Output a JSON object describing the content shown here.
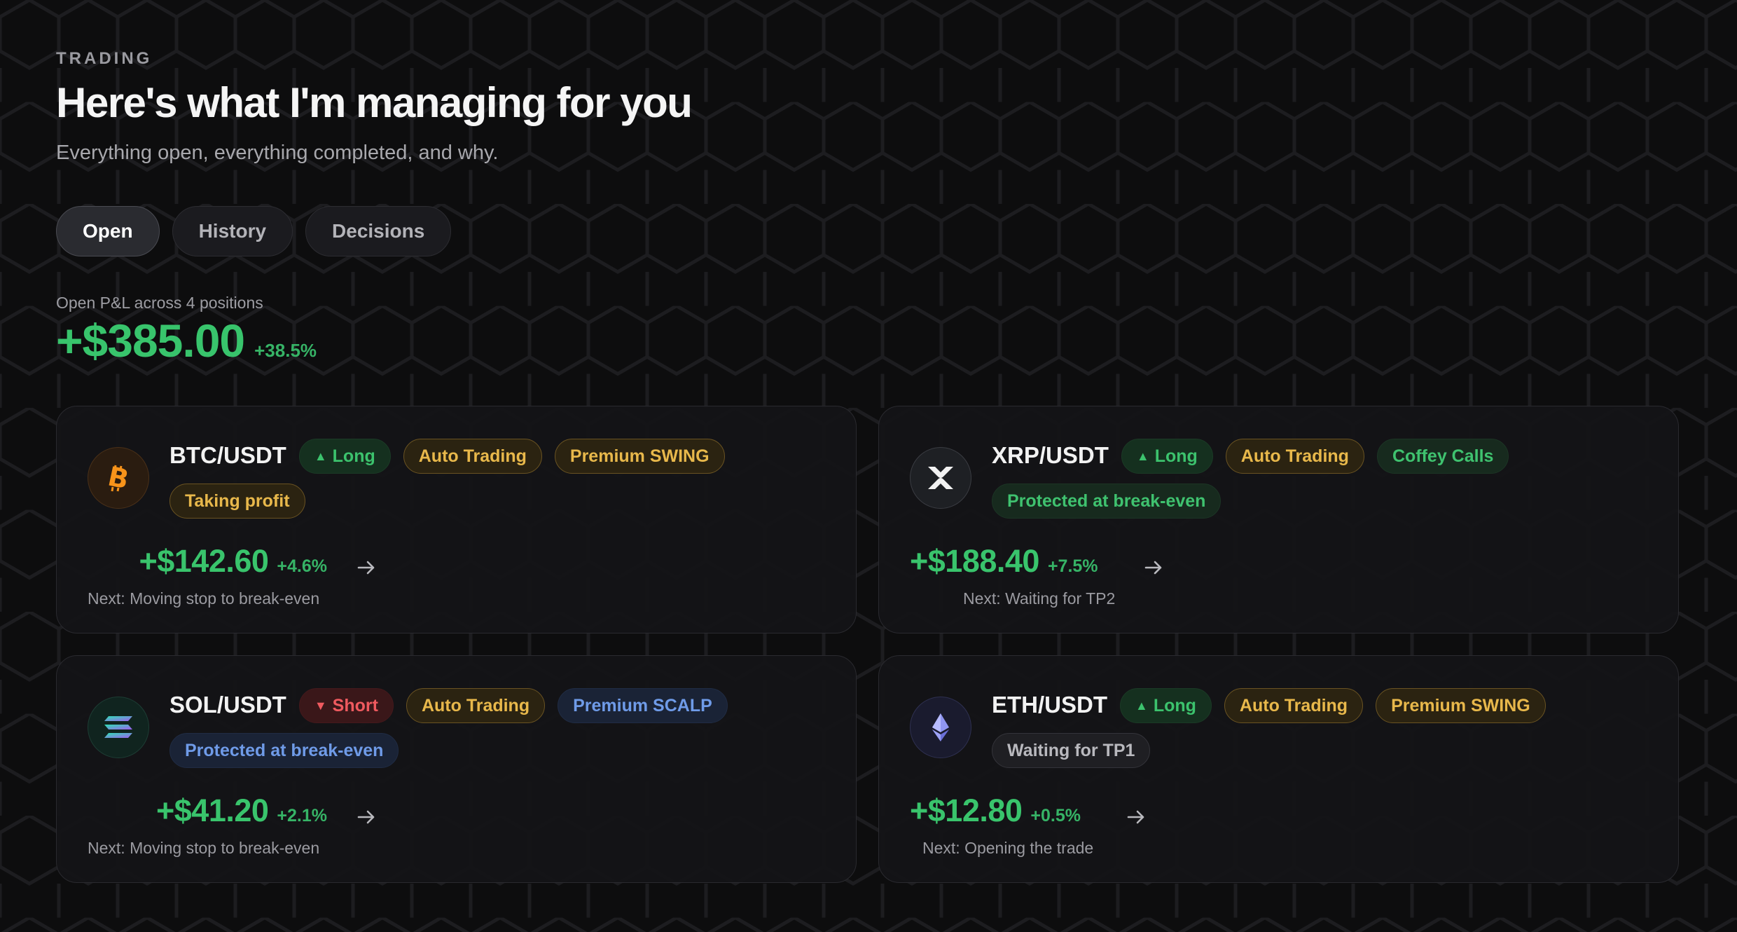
{
  "header": {
    "eyebrow": "TRADING",
    "title": "Here's what I'm managing for you",
    "subtitle": "Everything open, everything completed, and why."
  },
  "tabs": [
    {
      "label": "Open",
      "active": true
    },
    {
      "label": "History",
      "active": false
    },
    {
      "label": "Decisions",
      "active": false
    }
  ],
  "summary": {
    "label": "Open P&L across 4 positions",
    "value": "+$385.00",
    "pct": "+38.5%"
  },
  "positions": [
    {
      "pair": "BTC/USDT",
      "icon": "bitcoin-icon",
      "direction": "Long",
      "mode": "Auto Trading",
      "source": "Premium SWING",
      "status": "Taking profit",
      "pnl": "+$142.60",
      "pnl_pct": "+4.6%",
      "next": "Next: Moving stop to break-even"
    },
    {
      "pair": "XRP/USDT",
      "icon": "xrp-icon",
      "direction": "Long",
      "mode": "Auto Trading",
      "source": "Coffey Calls",
      "status": "Protected at break-even",
      "pnl": "+$188.40",
      "pnl_pct": "+7.5%",
      "next": "Next: Waiting for TP2"
    },
    {
      "pair": "SOL/USDT",
      "icon": "solana-icon",
      "direction": "Short",
      "mode": "Auto Trading",
      "source": "Premium SCALP",
      "status": "Protected at break-even",
      "pnl": "+$41.20",
      "pnl_pct": "+2.1%",
      "next": "Next: Moving stop to break-even"
    },
    {
      "pair": "ETH/USDT",
      "icon": "ethereum-icon",
      "direction": "Long",
      "mode": "Auto Trading",
      "source": "Premium SWING",
      "status": "Waiting for TP1",
      "pnl": "+$12.80",
      "pnl_pct": "+0.5%",
      "next": "Next: Opening the trade"
    }
  ],
  "colors": {
    "positive": "#38c46c",
    "negative": "#ef5a5f",
    "gold": "#e8b84b",
    "blue": "#6f9be8"
  }
}
